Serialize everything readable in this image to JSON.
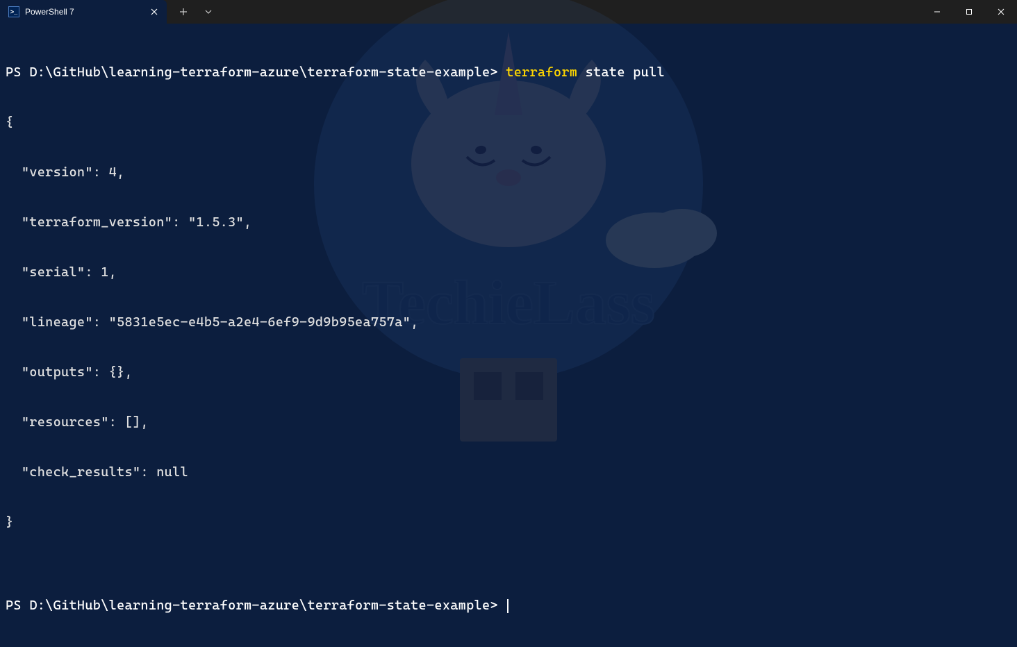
{
  "titlebar": {
    "tab_title": "PowerShell 7",
    "tab_icon_text": ">_"
  },
  "terminal": {
    "prompt1_prefix": "PS ",
    "prompt1_path": "D:\\GitHub\\learning-terraform-azure\\terraform-state-example",
    "prompt1_suffix": "> ",
    "cmd_highlighted": "terraform",
    "cmd_rest": " state pull",
    "output_lines": [
      "{",
      "  \"version\": 4,",
      "  \"terraform_version\": \"1.5.3\",",
      "  \"serial\": 1,",
      "  \"lineage\": \"5831e5ec-e4b5-a2e4-6ef9-9d9b95ea757a\",",
      "  \"outputs\": {},",
      "  \"resources\": [],",
      "  \"check_results\": null",
      "}",
      ""
    ],
    "prompt2_prefix": "PS ",
    "prompt2_path": "D:\\GitHub\\learning-terraform-azure\\terraform-state-example",
    "prompt2_suffix": "> "
  }
}
